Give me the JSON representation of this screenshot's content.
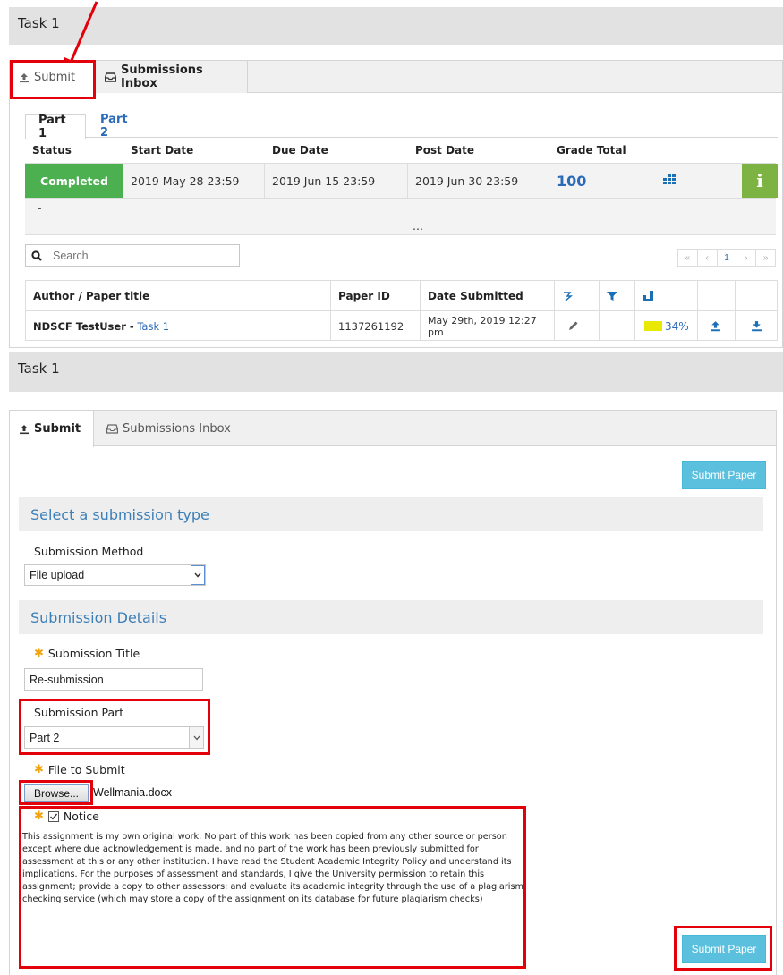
{
  "section1": {
    "title": "Task 1",
    "tabs": {
      "submit": "Submit",
      "inbox": "Submissions Inbox"
    },
    "parts": [
      "Part 1",
      "Part 2"
    ],
    "status_headers": {
      "status": "Status",
      "start": "Start Date",
      "due": "Due Date",
      "post": "Post Date",
      "grade": "Grade Total"
    },
    "status_row": {
      "status": "Completed",
      "start": "2019 May 28 23:59",
      "due": "2019 Jun 15 23:59",
      "post": "2019 Jun 30 23:59",
      "grade": "100"
    },
    "dash": "-",
    "ellipsis": "...",
    "search_placeholder": "Search",
    "pagination": {
      "first": "«",
      "prev": "‹",
      "page": "1",
      "next": "›",
      "last": "»"
    },
    "table_headers": {
      "author": "Author / Paper title",
      "paper_id": "Paper ID",
      "date": "Date Submitted"
    },
    "row": {
      "author": "NDSCF TestUser - ",
      "title_link": "Task 1",
      "paper_id": "1137261192",
      "date": "May 29th, 2019 12:27 pm",
      "similarity": "34%"
    },
    "colors": {
      "completed": "#4caf50",
      "info": "#7cb342",
      "link": "#2a6ab8",
      "similarity": "#e8e800"
    }
  },
  "section2": {
    "title": "Task 1",
    "tabs": {
      "submit": "Submit",
      "inbox": "Submissions Inbox"
    },
    "submit_button": "Submit Paper",
    "select_type_heading": "Select a submission type",
    "method_label": "Submission Method",
    "method_value": "File upload",
    "details_heading": "Submission Details",
    "title_label": "Submission Title",
    "title_value": "Re-submission",
    "part_label": "Submission Part",
    "part_value": "Part 2",
    "file_label": "File to Submit",
    "browse_button": "Browse...",
    "file_name": "Wellmania.docx",
    "notice_label": "Notice",
    "notice_text": "This assignment is my own original work. No part of this work has been copied from any other source or person except where due acknowledgement is made, and no part of the work has been previously submitted for assessment at this or any other institution. I have read the Student Academic Integrity Policy and understand its implications. For the purposes of assessment and standards, I give the University permission to retain this assignment; provide a copy to other assessors; and evaluate its academic integrity through the use of a plagiarism checking service (which may store a copy of the assignment on its database for future plagiarism checks)",
    "submit_button_bottom": "Submit Paper"
  }
}
